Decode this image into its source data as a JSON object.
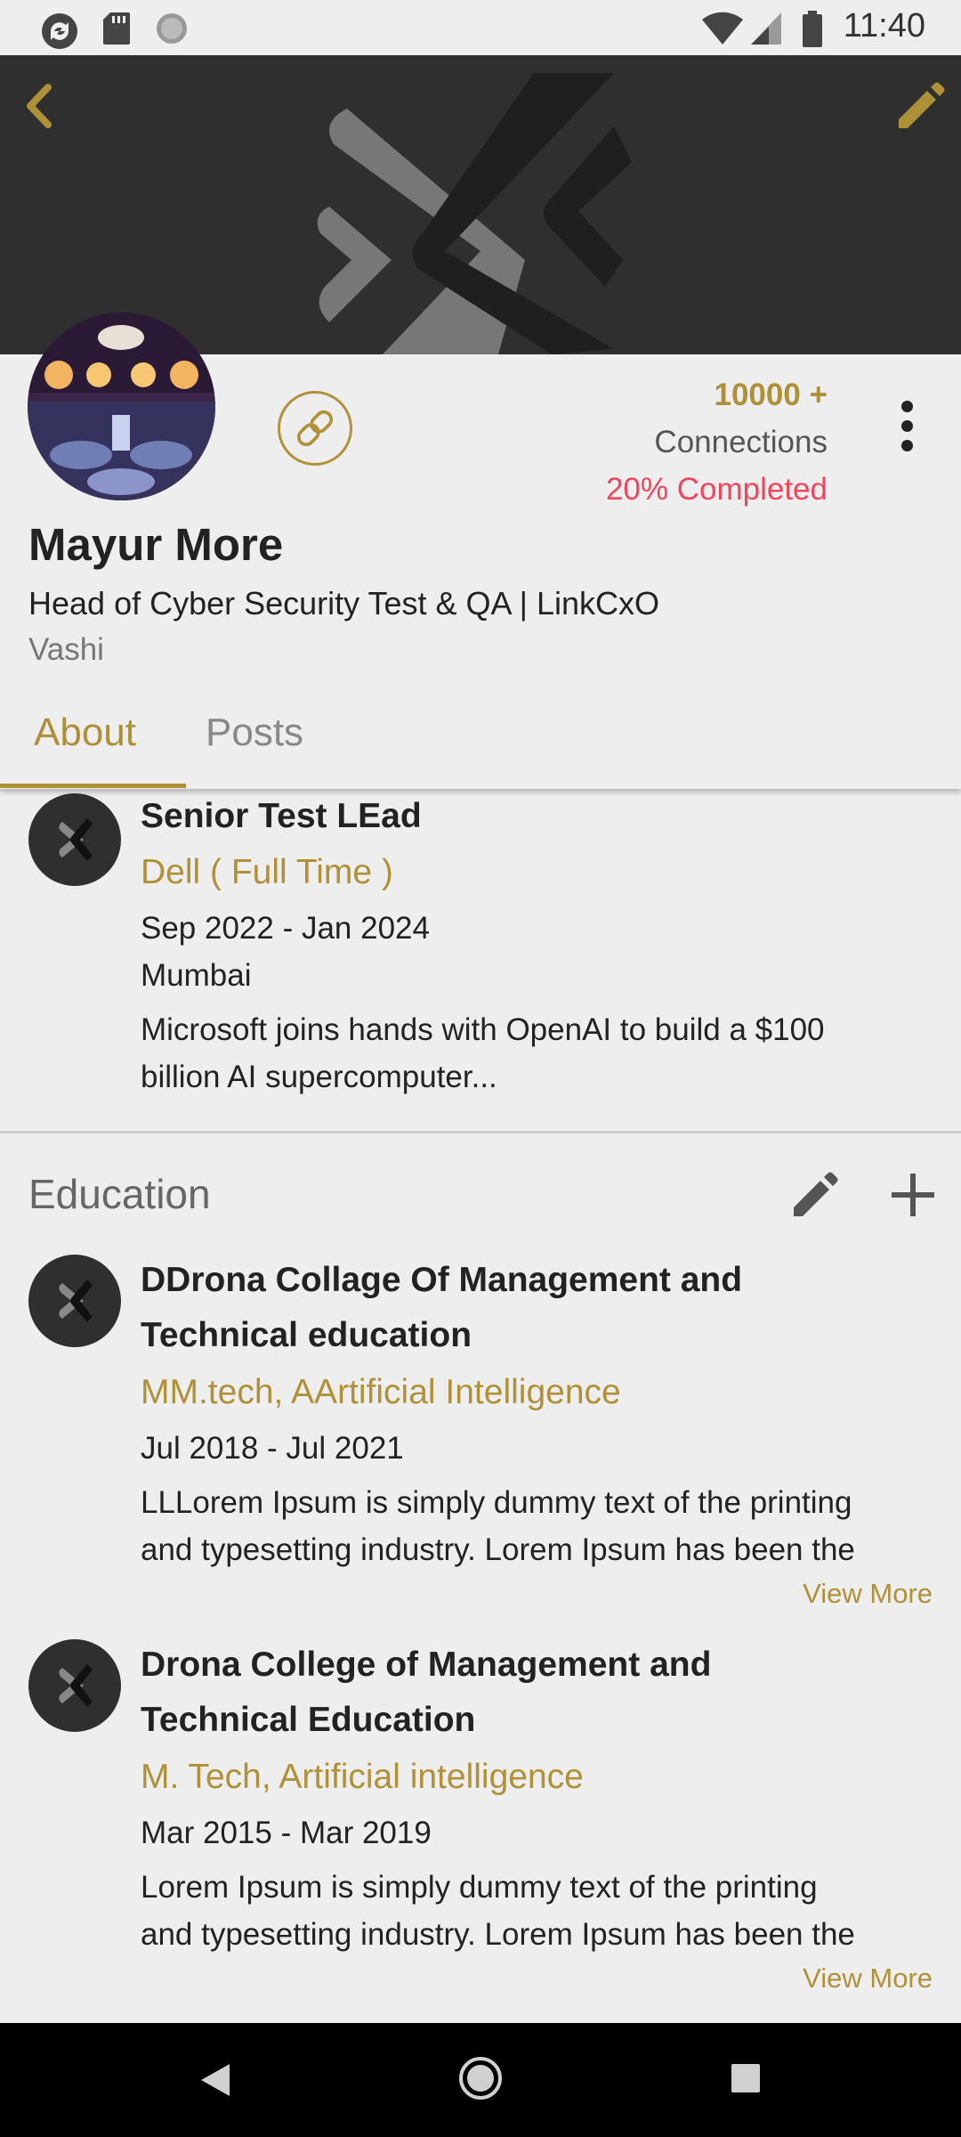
{
  "status_bar": {
    "time": "11:40",
    "icons": [
      "sync-icon",
      "sd-card-icon",
      "record-icon",
      "wifi-icon",
      "signal-icon",
      "battery-icon"
    ]
  },
  "header": {
    "back_icon": "chevron-left-icon",
    "edit_icon": "pencil-icon",
    "accent_color": "#ad9038"
  },
  "profile": {
    "connections_count": "10000 +",
    "connections_label": "Connections",
    "completion": "20%  Completed",
    "name": "Mayur More",
    "headline": "Head of Cyber Security Test & QA | LinkCxO",
    "location": "Vashi"
  },
  "tabs": [
    {
      "label": "About",
      "active": true
    },
    {
      "label": "Posts",
      "active": false
    }
  ],
  "experience": [
    {
      "title": "Senior Test LEad",
      "company": "Dell ( Full Time )",
      "dates": "Sep 2022 - Jan 2024",
      "location": "Mumbai",
      "description_line1": "Microsoft joins hands with OpenAI to build a $100",
      "description_line2": "billion AI supercomputer..."
    }
  ],
  "education": {
    "title": "Education",
    "items": [
      {
        "title_line1": "DDrona Collage Of Management and",
        "title_line2": "Technical education",
        "degree": "MM.tech, AArtificial Intelligence",
        "dates": "Jul 2018 - Jul 2021",
        "description_line1": "LLLorem Ipsum is simply dummy text of the printing",
        "description_line2": "and typesetting industry. Lorem Ipsum has been the",
        "view_more": "View More"
      },
      {
        "title_line1": "Drona College of Management and",
        "title_line2": "Technical Education",
        "degree": "M. Tech, Artificial intelligence",
        "dates": "Mar 2015 - Mar 2019",
        "description_line1": "Lorem Ipsum is simply dummy text of the printing",
        "description_line2": "and typesetting industry. Lorem Ipsum has been the",
        "view_more": "View More"
      }
    ]
  }
}
